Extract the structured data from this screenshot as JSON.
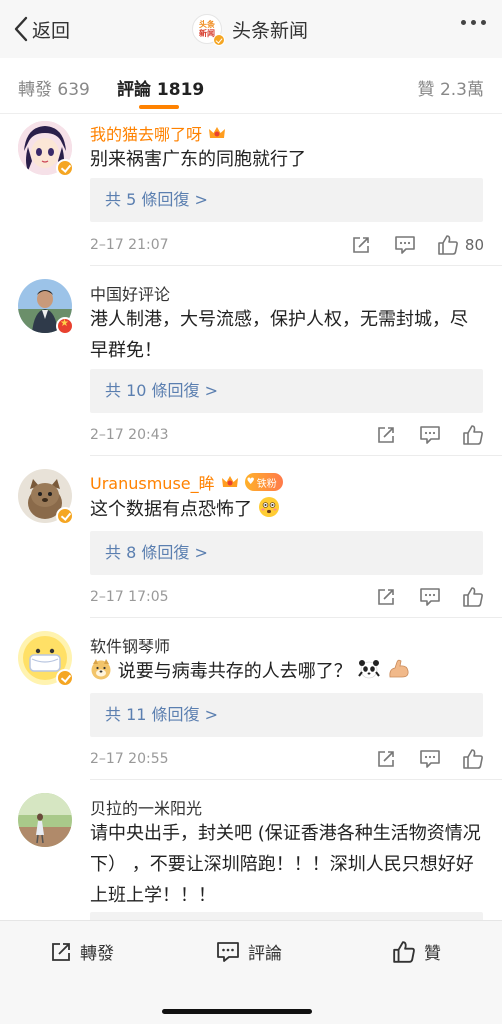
{
  "nav": {
    "back_label": "返回",
    "logo_line1": "头条",
    "logo_line2": "新闻",
    "title": "头条新闻",
    "more_icon": "more-icon"
  },
  "tabs": {
    "repost": "轉發 639",
    "comments": "評論 1819",
    "likes": "贊 2.3萬",
    "accent": "#ff8200"
  },
  "comments": [
    {
      "user": "我的猫去哪了呀",
      "vip": true,
      "text": "别来祸害广东的同胞就行了",
      "replies": "共 5 條回復 >",
      "time": "2–17 21:07",
      "likes": "80"
    },
    {
      "user": "中国好评论",
      "vip": false,
      "text": "港人制港，大号流感，保护人权，无需封城，尽早群免！",
      "replies": "共 10 條回復 >",
      "time": "2–17 20:43",
      "likes": ""
    },
    {
      "user": "Uranusmuse_眸",
      "vip": true,
      "fan_badge": "铁粉",
      "text": "这个数据有点恐怖了",
      "replies": "共 8 條回復 >",
      "time": "2–17 17:05",
      "likes": ""
    },
    {
      "user": "软件钢琴师",
      "vip": false,
      "text": "说要与病毒共存的人去哪了？",
      "replies": "共 11 條回復 >",
      "time": "2–17 20:55",
      "likes": ""
    },
    {
      "user": "贝拉的一米阳光",
      "vip": false,
      "text": "请中央出手，封关吧 (保证香港各种生活物资情况下） ，不要让深圳陪跑！！！深圳人民只想好好上班上学！！！"
    }
  ],
  "bottom": {
    "repost": "轉發",
    "comment": "評論",
    "like": "贊"
  },
  "colors": {
    "link_blue": "#5b7fb0",
    "vip_orange": "#ff8200",
    "verify_gold": "#f5a623"
  }
}
